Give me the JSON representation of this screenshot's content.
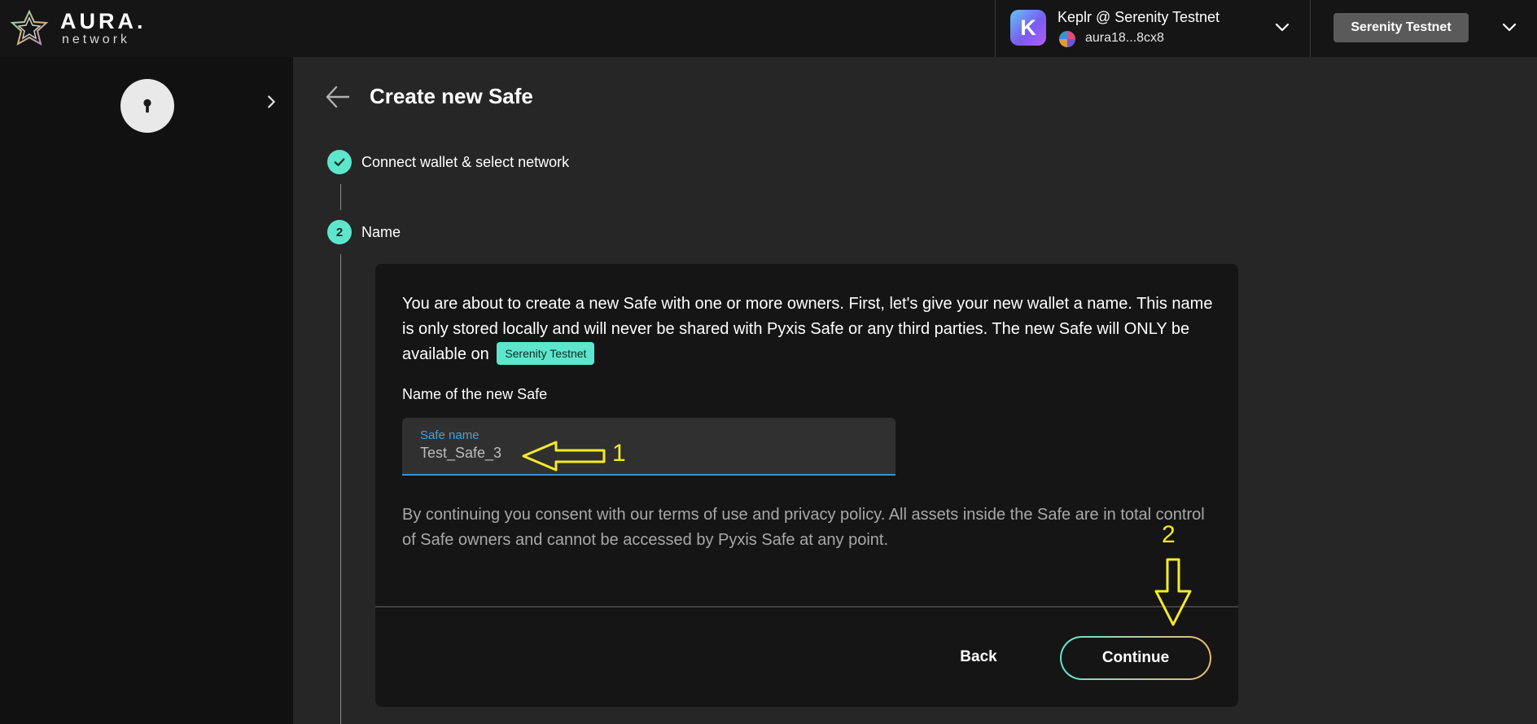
{
  "app": {
    "logo_word": "AURA.",
    "logo_sub": "network"
  },
  "wallet": {
    "name": "Keplr @ Serenity Testnet",
    "icon_letter": "K",
    "address": "aura18...8cx8",
    "icon": "chevron-down-icon"
  },
  "network": {
    "label": "Serenity Testnet",
    "icon": "chevron-down-icon"
  },
  "sidebar": {
    "icons": [
      "keyhole-icon",
      "chevron-right-icon"
    ]
  },
  "page": {
    "title": "Create new Safe",
    "back_icon": "arrow-left-icon"
  },
  "steps": [
    {
      "label": "Connect wallet & select network",
      "state": "done",
      "icon": "check-icon"
    },
    {
      "label": "Name",
      "number": "2",
      "state": "active"
    }
  ],
  "form": {
    "intro_text": "You are about to create a new Safe with one or more owners. First, let's give your new wallet a name. This name is only stored locally and will never be shared with Pyxis Safe or any third parties. The new Safe will ONLY be available on",
    "network_tag": "Serenity Testnet",
    "field_heading": "Name of the new Safe",
    "input_label": "Safe name",
    "input_value": "Test_Safe_3",
    "consent_text": "By continuing you consent with our terms of use and privacy policy. All assets inside the Safe are in total control of Safe owners and cannot be accessed by Pyxis Safe at any point.",
    "back_label": "Back",
    "continue_label": "Continue"
  },
  "annotations": {
    "marker_1": "1",
    "marker_2": "2",
    "color": "#f4ea2a"
  },
  "colors": {
    "accent": "#5ee6cd",
    "input_focus": "#2f95d6",
    "background": "#262626",
    "sidebar": "#111111",
    "card": "#151515"
  }
}
